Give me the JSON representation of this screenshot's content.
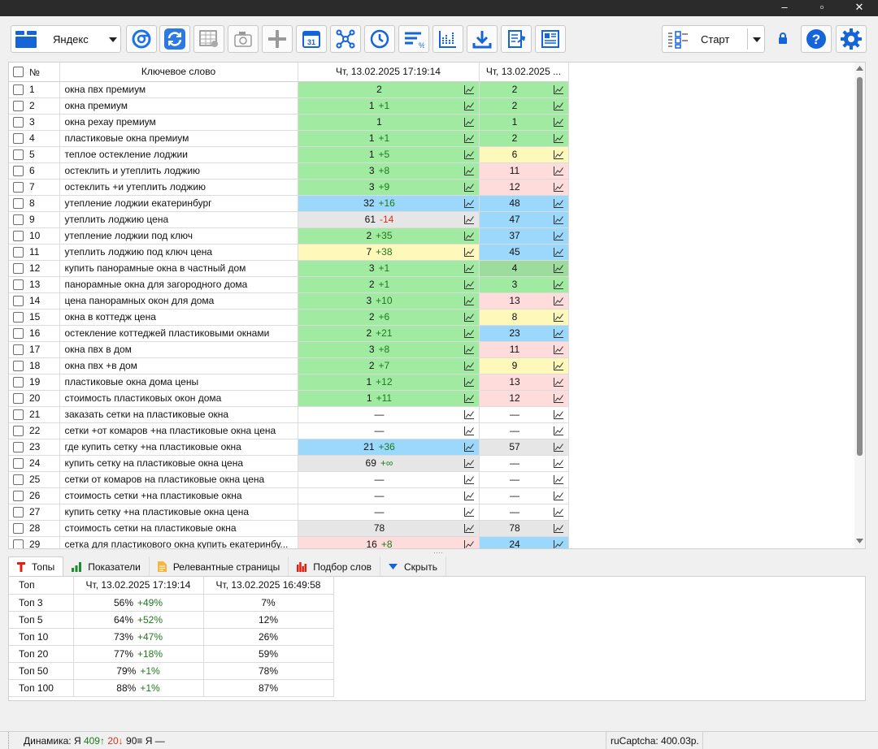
{
  "window": {
    "minimize": "–",
    "maximize": "▫",
    "close": "✕"
  },
  "toolbar": {
    "search_engine": "Яндекс",
    "calendar_day": "31",
    "start_label": "Старт"
  },
  "grid": {
    "headers": {
      "num": "№",
      "keyword": "Ключевое слово",
      "date1": "Чт, 13.02.2025 17:19:14",
      "date2": "Чт, 13.02.2025 ..."
    },
    "rows": [
      {
        "n": "1",
        "kw": "окна пвх премиум",
        "p1": "2",
        "d1": "",
        "c1": "g",
        "p2": "2",
        "c2": "g"
      },
      {
        "n": "2",
        "kw": "окна премиум",
        "p1": "1",
        "d1": "+1",
        "c1": "g",
        "p2": "2",
        "c2": "g"
      },
      {
        "n": "3",
        "kw": "окна рехау премиум",
        "p1": "1",
        "d1": "",
        "c1": "g",
        "p2": "1",
        "c2": "g"
      },
      {
        "n": "4",
        "kw": "пластиковые окна премиум",
        "p1": "1",
        "d1": "+1",
        "c1": "g",
        "p2": "2",
        "c2": "g"
      },
      {
        "n": "5",
        "kw": "теплое остекление лоджии",
        "p1": "1",
        "d1": "+5",
        "c1": "g",
        "p2": "6",
        "c2": "y"
      },
      {
        "n": "6",
        "kw": "остеклить и утеплить лоджию",
        "p1": "3",
        "d1": "+8",
        "c1": "g",
        "p2": "11",
        "c2": "r"
      },
      {
        "n": "7",
        "kw": "остеклить +и утеплить лоджию",
        "p1": "3",
        "d1": "+9",
        "c1": "g",
        "p2": "12",
        "c2": "r"
      },
      {
        "n": "8",
        "kw": "утепление лоджии екатеринбург",
        "p1": "32",
        "d1": "+16",
        "c1": "b",
        "p2": "48",
        "c2": "b"
      },
      {
        "n": "9",
        "kw": "утеплить лоджию цена",
        "p1": "61",
        "d1": "-14",
        "c1": "gr",
        "p2": "47",
        "c2": "b"
      },
      {
        "n": "10",
        "kw": "утепление лоджии под ключ",
        "p1": "2",
        "d1": "+35",
        "c1": "g",
        "p2": "37",
        "c2": "b"
      },
      {
        "n": "11",
        "kw": "утеплить лоджию под ключ цена",
        "p1": "7",
        "d1": "+38",
        "c1": "y",
        "p2": "45",
        "c2": "b"
      },
      {
        "n": "12",
        "kw": "купить панорамные окна в частный дом",
        "p1": "3",
        "d1": "+1",
        "c1": "g",
        "p2": "4",
        "c2": "g2"
      },
      {
        "n": "13",
        "kw": "панорамные окна для загородного дома",
        "p1": "2",
        "d1": "+1",
        "c1": "g",
        "p2": "3",
        "c2": "g"
      },
      {
        "n": "14",
        "kw": "цена панорамных окон для дома",
        "p1": "3",
        "d1": "+10",
        "c1": "g",
        "p2": "13",
        "c2": "r"
      },
      {
        "n": "15",
        "kw": "окна в коттедж цена",
        "p1": "2",
        "d1": "+6",
        "c1": "g",
        "p2": "8",
        "c2": "y"
      },
      {
        "n": "16",
        "kw": "остекление коттеджей пластиковыми окнами",
        "p1": "2",
        "d1": "+21",
        "c1": "g",
        "p2": "23",
        "c2": "b"
      },
      {
        "n": "17",
        "kw": "окна пвх в дом",
        "p1": "3",
        "d1": "+8",
        "c1": "g",
        "p2": "11",
        "c2": "r"
      },
      {
        "n": "18",
        "kw": "окна пвх +в дом",
        "p1": "2",
        "d1": "+7",
        "c1": "g",
        "p2": "9",
        "c2": "y"
      },
      {
        "n": "19",
        "kw": "пластиковые окна дома цены",
        "p1": "1",
        "d1": "+12",
        "c1": "g",
        "p2": "13",
        "c2": "r"
      },
      {
        "n": "20",
        "kw": "стоимость пластиковых окон дома",
        "p1": "1",
        "d1": "+11",
        "c1": "g",
        "p2": "12",
        "c2": "r"
      },
      {
        "n": "21",
        "kw": "заказать сетки на пластиковые окна",
        "p1": "—",
        "d1": "",
        "c1": "w",
        "p2": "—",
        "c2": "w"
      },
      {
        "n": "22",
        "kw": "сетки +от комаров +на пластиковые окна цена",
        "p1": "—",
        "d1": "",
        "c1": "w",
        "p2": "—",
        "c2": "w"
      },
      {
        "n": "23",
        "kw": "где купить сетку +на пластиковые окна",
        "p1": "21",
        "d1": "+36",
        "c1": "b",
        "p2": "57",
        "c2": "gr"
      },
      {
        "n": "24",
        "kw": "купить сетку на пластиковые окна цена",
        "p1": "69",
        "d1": "+∞",
        "c1": "gr",
        "p2": "—",
        "c2": "w"
      },
      {
        "n": "25",
        "kw": "сетки от комаров на пластиковые окна цена",
        "p1": "—",
        "d1": "",
        "c1": "w",
        "p2": "—",
        "c2": "w"
      },
      {
        "n": "26",
        "kw": "стоимость сетки +на пластиковые окна",
        "p1": "—",
        "d1": "",
        "c1": "w",
        "p2": "—",
        "c2": "w"
      },
      {
        "n": "27",
        "kw": "купить сетку +на пластиковые окна цена",
        "p1": "—",
        "d1": "",
        "c1": "w",
        "p2": "—",
        "c2": "w"
      },
      {
        "n": "28",
        "kw": "стоимость сетки на пластиковые окна",
        "p1": "78",
        "d1": "",
        "c1": "gr",
        "p2": "78",
        "c2": "gr"
      },
      {
        "n": "29",
        "kw": "сетка для пластикового окна купить екатеринбу...",
        "p1": "16",
        "d1": "+8",
        "c1": "r",
        "p2": "24",
        "c2": "b"
      }
    ]
  },
  "tabs": [
    {
      "label": "Топы",
      "icon": "t-icon",
      "active": true
    },
    {
      "label": "Показатели",
      "icon": "bar-chart-icon"
    },
    {
      "label": "Релевантные страницы",
      "icon": "document-icon"
    },
    {
      "label": "Подбор слов",
      "icon": "bar-chart-red-icon"
    },
    {
      "label": "Скрыть",
      "icon": "chevron-down-icon"
    }
  ],
  "tops": {
    "headers": {
      "label": "Топ",
      "date1": "Чт, 13.02.2025 17:19:14",
      "date2": "Чт, 13.02.2025 16:49:58"
    },
    "rows": [
      {
        "label": "Топ 3",
        "v1": "56%",
        "d1": "+49%",
        "v2": "7%"
      },
      {
        "label": "Топ 5",
        "v1": "64%",
        "d1": "+52%",
        "v2": "12%"
      },
      {
        "label": "Топ 10",
        "v1": "73%",
        "d1": "+47%",
        "v2": "26%"
      },
      {
        "label": "Топ 20",
        "v1": "77%",
        "d1": "+18%",
        "v2": "59%"
      },
      {
        "label": "Топ 50",
        "v1": "79%",
        "d1": "+1%",
        "v2": "78%"
      },
      {
        "label": "Топ 100",
        "v1": "88%",
        "d1": "+1%",
        "v2": "87%"
      }
    ]
  },
  "status": {
    "dyn_label": "Динамика: Я",
    "up": "409↑",
    "down": "20↓",
    "same": "90≡ Я —",
    "captcha": "ruCaptcha: 400.03р."
  },
  "colors": {
    "accent": "#1a73e8",
    "green": "#a1eaa1",
    "yellow": "#fff8bb",
    "blue": "#9bd8fb",
    "red": "#ffdcdc",
    "gray": "#e6e6e6"
  }
}
